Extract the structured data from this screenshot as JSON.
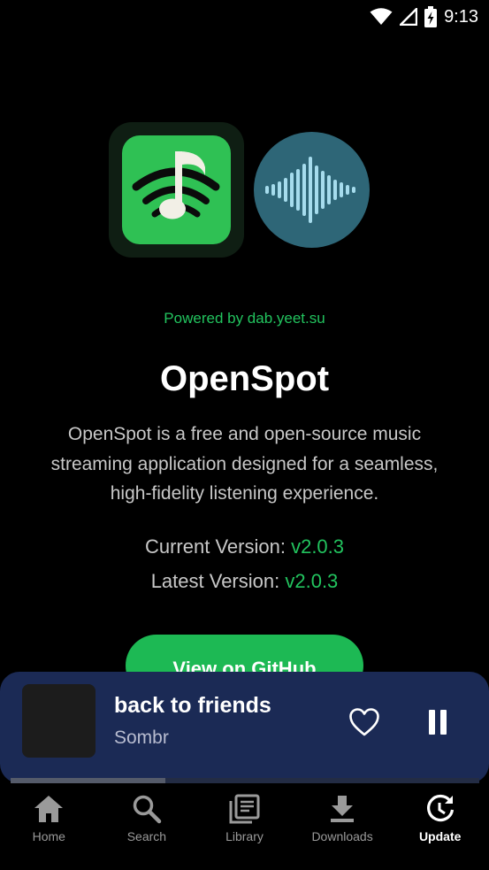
{
  "status_bar": {
    "time": "9:13",
    "icons": [
      "wifi-icon",
      "signal-icon",
      "battery-icon"
    ]
  },
  "header": {
    "logos": [
      "app-logo-icon",
      "waveform-logo-icon"
    ]
  },
  "about": {
    "powered_by": "Powered by dab.yeet.su",
    "title": "OpenSpot",
    "description": "OpenSpot is a free and open-source music streaming application designed for a seamless, high-fidelity listening experience.",
    "current_version_label": "Current Version:",
    "current_version_value": "v2.0.3",
    "latest_version_label": "Latest Version:",
    "latest_version_value": "v2.0.3",
    "github_button": "View on GitHub"
  },
  "player": {
    "track_title": "back to friends",
    "artist": "Sombr",
    "progress": 0.33,
    "icons": [
      "heart-icon",
      "pause-icon"
    ]
  },
  "nav": {
    "items": [
      {
        "label": "Home",
        "icon": "home-icon",
        "active": false
      },
      {
        "label": "Search",
        "icon": "search-icon",
        "active": false
      },
      {
        "label": "Library",
        "icon": "library-icon",
        "active": false
      },
      {
        "label": "Downloads",
        "icon": "download-icon",
        "active": false
      },
      {
        "label": "Update",
        "icon": "update-icon",
        "active": true
      }
    ]
  },
  "colors": {
    "accent": "#1db954",
    "accent_text": "#22c35e",
    "player_bg": "#1b2a55",
    "background": "#000000"
  }
}
